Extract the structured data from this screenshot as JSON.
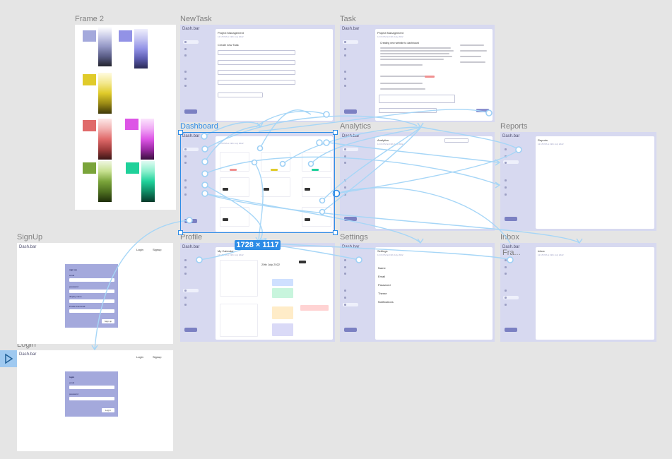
{
  "canvas": {
    "background": "#e5e5e5",
    "link_color": "#a6d6f7",
    "selection_color": "#2d8ce6"
  },
  "frames": {
    "frame2": {
      "label": "Frame 2"
    },
    "newtask": {
      "label": "NewTask",
      "brand": "Dash.bar",
      "title": "Project Management",
      "subtitle": "12:15 PM at 19th July 2022",
      "heading": "Create new Task"
    },
    "task": {
      "label": "Task",
      "brand": "Dash.bar",
      "title": "Project Management",
      "subtitle": "12:15 PM at 19th July 2022",
      "heading": "Creating new website to dashboard"
    },
    "dashboard": {
      "label": "Dashboard",
      "brand": "Dash.bar",
      "subtitle": "12:15 PM at 19th July 2022"
    },
    "analytics": {
      "label": "Analytics",
      "brand": "Dash.bar",
      "title": "Analytics",
      "subtitle": "12:15 PM at 19th July 2022"
    },
    "reports": {
      "label": "Reports",
      "brand": "Dash.bar",
      "title": "Reports",
      "subtitle": "12:15 PM at 19th July 2022"
    },
    "profile": {
      "label": "Profile",
      "brand": "Dash.bar",
      "title": "My Calendar",
      "subtitle": "12:15 PM at 19th July 2022",
      "date_heading": "20th July 2022"
    },
    "settings": {
      "label": "Settings",
      "brand": "Dash.bar",
      "title": "Settings",
      "subtitle": "12:15 PM at 19th July 2022",
      "items": [
        "Name",
        "Email",
        "Password",
        "Theme",
        "Notifications"
      ]
    },
    "inbox": {
      "label": "Inbox",
      "overlay_label": "Fra...",
      "brand": "Dash.bar",
      "title": "Inbox",
      "subtitle": "12:15 PM at 19th July 2022"
    },
    "signup": {
      "label": "SignUp",
      "brand": "Dash.bar",
      "nav_login": "Login",
      "nav_signup": "Signup",
      "heading": "sign up",
      "fields": [
        "email",
        "password",
        "display name",
        "Profile thumbnail"
      ],
      "button": "Sign up"
    },
    "login": {
      "label": "Login",
      "brand": "Dash.bar",
      "nav_login": "Login",
      "nav_signup": "Signup",
      "heading": "login",
      "fields": [
        "email",
        "password"
      ],
      "button": "Log in"
    }
  },
  "selection": {
    "size_badge": "1728 × 1117"
  },
  "swatches": [
    {
      "color": "#a4a9dc",
      "ramp": [
        "#ffffff",
        "#c9cbe8",
        "#9396c4",
        "#5a5d86",
        "#23242e"
      ]
    },
    {
      "color": "#9292e6",
      "ramp": [
        "#eeeefc",
        "#c4c4f2",
        "#9292e6",
        "#5c5cb0",
        "#2a2a55"
      ]
    },
    {
      "color": "#e0cb2a",
      "ramp": [
        "#fffbe0",
        "#f3e88e",
        "#e0cb2a",
        "#9a8a15",
        "#3e3808"
      ]
    },
    {
      "color": "#e06a6a",
      "ramp": [
        "#fde8e8",
        "#f2b0b0",
        "#e06a6a",
        "#a03c3c",
        "#3a1616"
      ]
    },
    {
      "color": "#dd55e6",
      "ramp": [
        "#fbe4fd",
        "#f0a8f5",
        "#dd55e6",
        "#9a2aa3",
        "#3a0f3e"
      ]
    },
    {
      "color": "#7aa43a",
      "ramp": [
        "#eef6e0",
        "#c6e090",
        "#7aa43a",
        "#4e7020",
        "#1e2e0a"
      ]
    },
    {
      "color": "#1fd19a",
      "ramp": [
        "#e0fbf2",
        "#8cf0cd",
        "#1fd19a",
        "#0f8a64",
        "#073a2a"
      ]
    }
  ]
}
